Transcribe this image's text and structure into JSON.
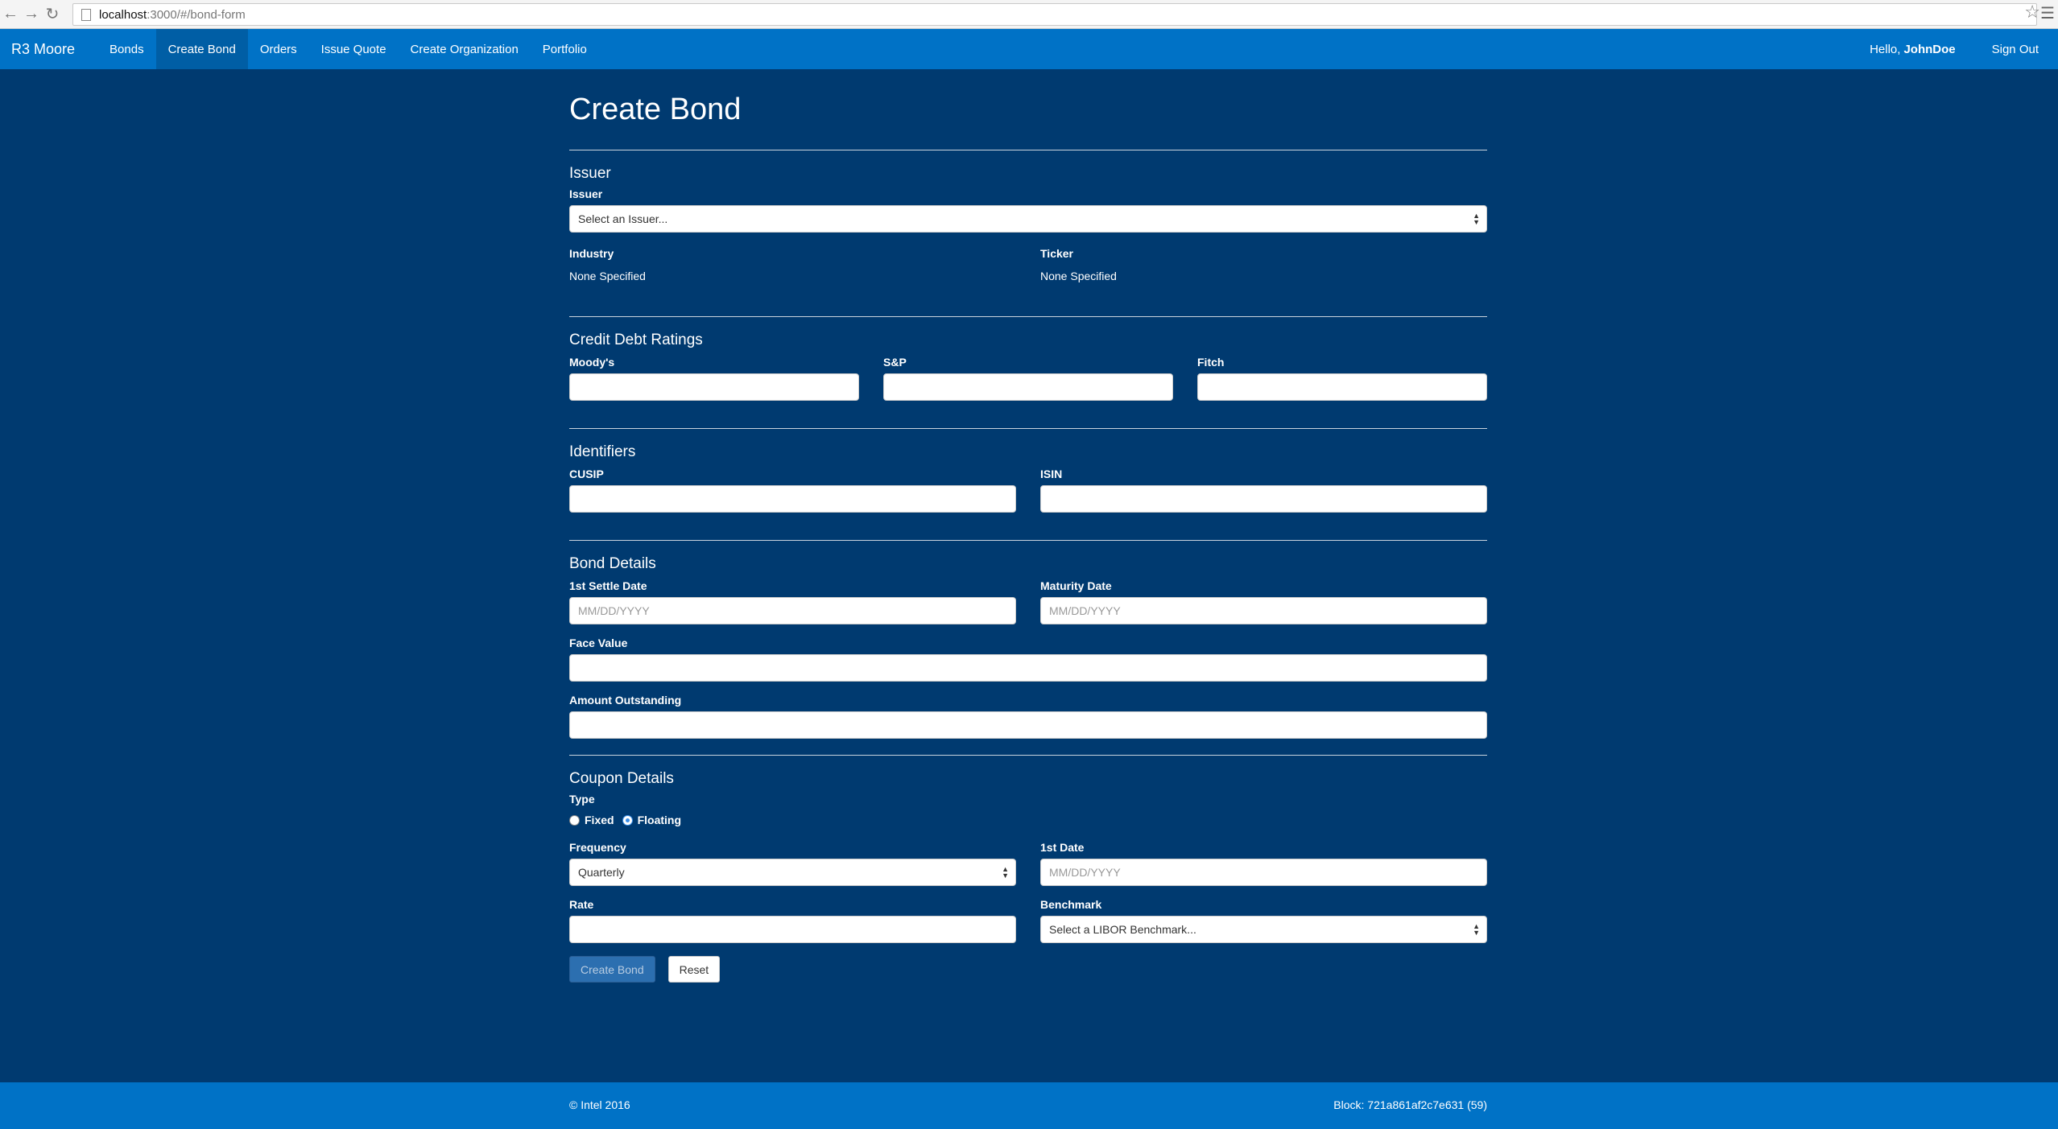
{
  "browser": {
    "url_host": "localhost",
    "url_path": ":3000/#/bond-form"
  },
  "navbar": {
    "brand": "R3 Moore",
    "items": [
      {
        "label": "Bonds",
        "active": false
      },
      {
        "label": "Create Bond",
        "active": true
      },
      {
        "label": "Orders",
        "active": false
      },
      {
        "label": "Issue Quote",
        "active": false
      },
      {
        "label": "Create Organization",
        "active": false
      },
      {
        "label": "Portfolio",
        "active": false
      }
    ],
    "hello_prefix": "Hello,",
    "username": "JohnDoe",
    "sign_out": "Sign Out"
  },
  "form": {
    "title": "Create Bond",
    "issuer_section": {
      "title": "Issuer",
      "issuer_label": "Issuer",
      "issuer_select_value": "Select an Issuer...",
      "industry_label": "Industry",
      "industry_value": "None Specified",
      "ticker_label": "Ticker",
      "ticker_value": "None Specified"
    },
    "ratings_section": {
      "title": "Credit Debt Ratings",
      "moodys_label": "Moody's",
      "moodys_value": "",
      "sp_label": "S&P",
      "sp_value": "",
      "fitch_label": "Fitch",
      "fitch_value": ""
    },
    "identifiers_section": {
      "title": "Identifiers",
      "cusip_label": "CUSIP",
      "cusip_value": "",
      "isin_label": "ISIN",
      "isin_value": ""
    },
    "bond_details_section": {
      "title": "Bond Details",
      "settle_label": "1st Settle Date",
      "settle_placeholder": "MM/DD/YYYY",
      "maturity_label": "Maturity Date",
      "maturity_placeholder": "MM/DD/YYYY",
      "face_value_label": "Face Value",
      "face_value": "",
      "amount_outstanding_label": "Amount Outstanding",
      "amount_outstanding": ""
    },
    "coupon_section": {
      "title": "Coupon Details",
      "type_label": "Type",
      "type_options": [
        {
          "label": "Fixed",
          "checked": false
        },
        {
          "label": "Floating",
          "checked": true
        }
      ],
      "frequency_label": "Frequency",
      "frequency_value": "Quarterly",
      "first_date_label": "1st Date",
      "first_date_placeholder": "MM/DD/YYYY",
      "rate_label": "Rate",
      "rate_value": "",
      "benchmark_label": "Benchmark",
      "benchmark_value": "Select a LIBOR Benchmark..."
    },
    "buttons": {
      "create": "Create Bond",
      "reset": "Reset"
    }
  },
  "footer": {
    "copyright": "© Intel 2016",
    "block": "Block: 721a861af2c7e631 (59)"
  },
  "colors": {
    "page_background": "#003a70",
    "navbar": "#0072c6",
    "navbar_active": "#005ea5",
    "primary_button": "#2c6fb0"
  }
}
